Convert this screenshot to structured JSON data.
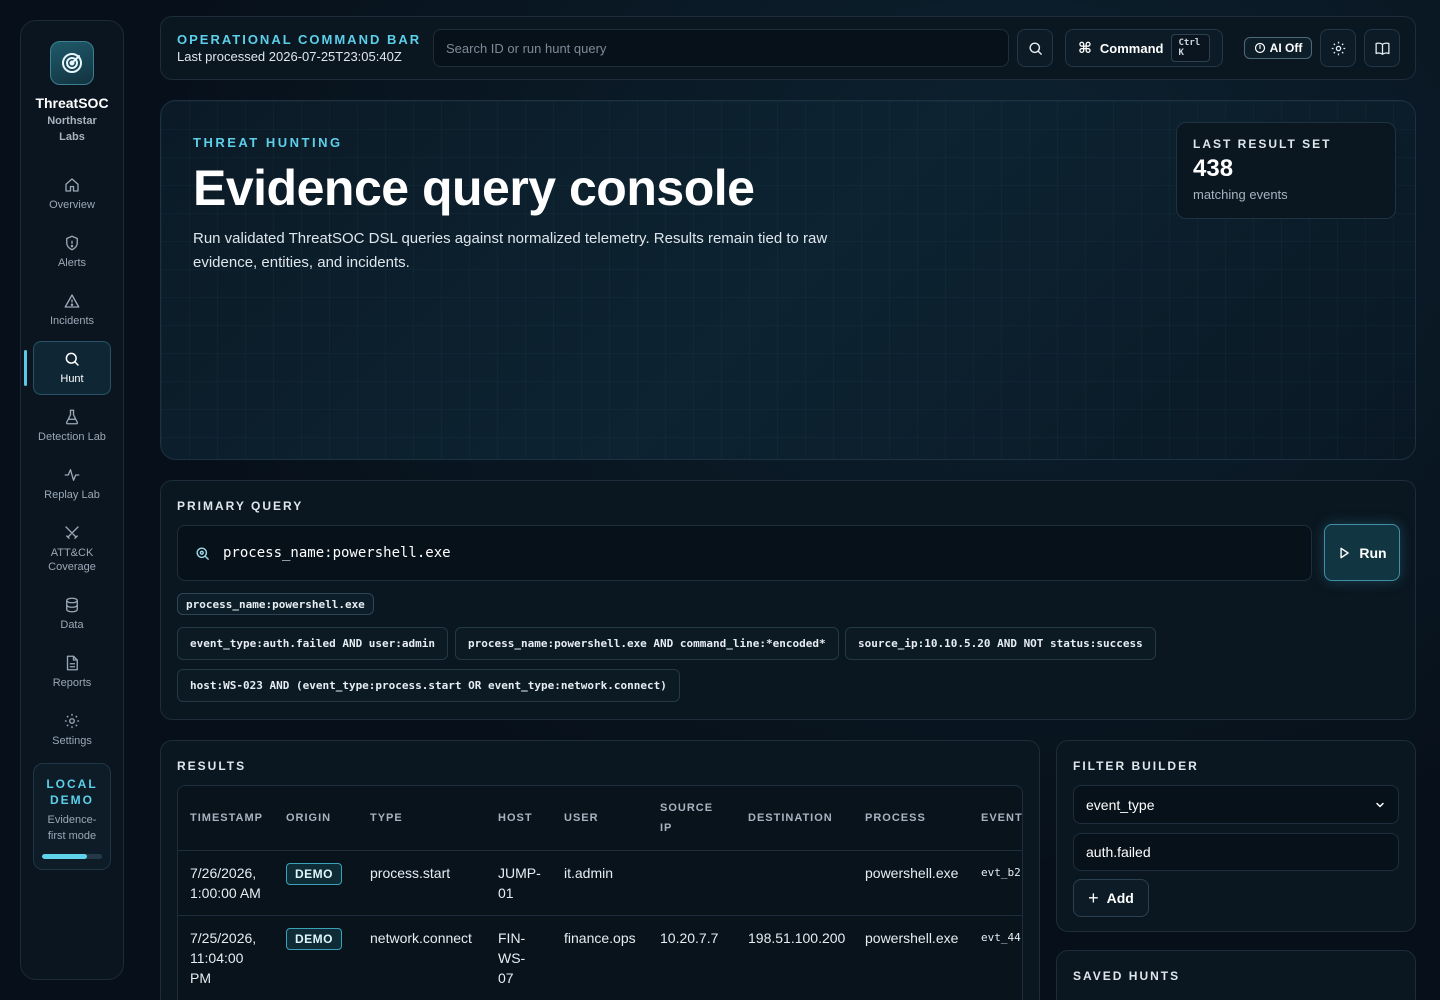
{
  "brand": {
    "name": "ThreatSOC",
    "org": "Northstar Labs"
  },
  "nav": {
    "items": [
      {
        "label": "Overview",
        "icon": "home-icon"
      },
      {
        "label": "Alerts",
        "icon": "shield-icon"
      },
      {
        "label": "Incidents",
        "icon": "warning-icon"
      },
      {
        "label": "Hunt",
        "icon": "search-icon",
        "active": true
      },
      {
        "label": "Detection Lab",
        "icon": "flask-icon"
      },
      {
        "label": "Replay Lab",
        "icon": "activity-icon"
      },
      {
        "label": "ATT&CK Coverage",
        "icon": "crossed-swords-icon"
      },
      {
        "label": "Data",
        "icon": "database-icon"
      },
      {
        "label": "Reports",
        "icon": "document-icon"
      },
      {
        "label": "Settings",
        "icon": "gear-icon"
      }
    ]
  },
  "demo": {
    "title": "LOCAL DEMO",
    "subtitle": "Evidence-first mode",
    "progress": 0.75
  },
  "topbar": {
    "title": "OPERATIONAL COMMAND BAR",
    "last_processed": "Last processed 2026-07-25T23:05:40Z",
    "search_placeholder": "Search ID or run hunt query",
    "command_label": "Command",
    "command_shortcut": "Ctrl K",
    "ai_label": "AI Off"
  },
  "hero": {
    "eyebrow": "THREAT HUNTING",
    "title": "Evidence query console",
    "description": "Run validated ThreatSOC DSL queries against normalized telemetry. Results remain tied to raw evidence, entities, and incidents.",
    "last_result_label": "LAST RESULT SET",
    "last_result_value": "438",
    "last_result_sub": "matching events"
  },
  "query": {
    "label": "PRIMARY QUERY",
    "value": "process_name:powershell.exe",
    "run_label": "Run",
    "active_chip": "process_name:powershell.exe",
    "examples": [
      "event_type:auth.failed AND user:admin",
      "process_name:powershell.exe AND command_line:*encoded*",
      "source_ip:10.10.5.20 AND NOT status:success",
      "host:WS-023 AND (event_type:process.start OR event_type:network.connect)"
    ]
  },
  "results": {
    "label": "RESULTS",
    "headers": [
      "TIMESTAMP",
      "ORIGIN",
      "TYPE",
      "HOST",
      "USER",
      "SOURCE IP",
      "DESTINATION",
      "PROCESS",
      "EVENT"
    ],
    "rows": [
      {
        "timestamp": "7/26/2026, 1:00:00 AM",
        "origin": "DEMO",
        "type": "process.start",
        "host": "JUMP-01",
        "user": "it.admin",
        "source_ip": "",
        "destination": "",
        "process": "powershell.exe",
        "event": "evt_b2"
      },
      {
        "timestamp": "7/25/2026, 11:04:00 PM",
        "origin": "DEMO",
        "type": "network.connect",
        "host": "FIN-WS-07",
        "user": "finance.ops",
        "source_ip": "10.20.7.7",
        "destination": "198.51.100.200",
        "process": "powershell.exe",
        "event": "evt_44"
      }
    ]
  },
  "filter": {
    "label": "FILTER BUILDER",
    "field_value": "event_type",
    "value": "auth.failed",
    "add_label": "Add"
  },
  "saved": {
    "label": "SAVED HUNTS"
  }
}
